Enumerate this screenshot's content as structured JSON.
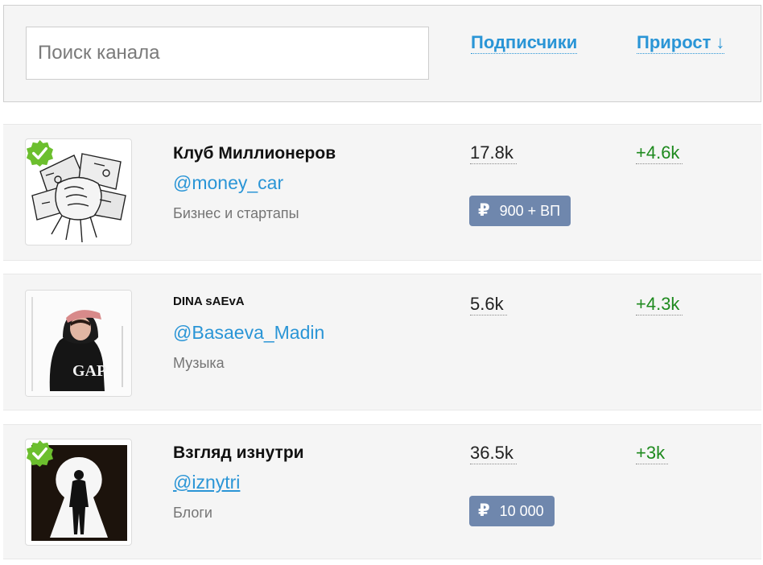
{
  "search": {
    "placeholder": "Поиск канала",
    "value": ""
  },
  "sort": {
    "subscribers_label": "Подписчики",
    "growth_label": "Прирост",
    "growth_arrow": "↓"
  },
  "colors": {
    "link": "#2a95d6",
    "growth": "#1e8a1e",
    "price_badge": "#6f87ad",
    "verified": "#6cbf2e"
  },
  "channels": [
    {
      "name": "Клуб Миллионеров",
      "handle": "@money_car",
      "category": "Бизнес и стартапы",
      "subscribers": "17.8k",
      "growth": "+4.6k",
      "verified": true,
      "price_icon": "₽",
      "price": "900 + ВП",
      "avatar_icon": "money-fist-icon"
    },
    {
      "name": "DINA sAEvA",
      "handle": "@Basaeva_Madin",
      "category": "Музыка",
      "subscribers": "5.6k",
      "growth": "+4.3k",
      "verified": false,
      "avatar_icon": "person-hoodie-photo"
    },
    {
      "name": "Взгляд изнутри",
      "handle": "@iznytri",
      "category": "Блоги",
      "subscribers": "36.5k",
      "growth": "+3k",
      "verified": true,
      "price_icon": "₽",
      "price": "10 000",
      "avatar_icon": "keyhole-silhouette-icon"
    }
  ]
}
